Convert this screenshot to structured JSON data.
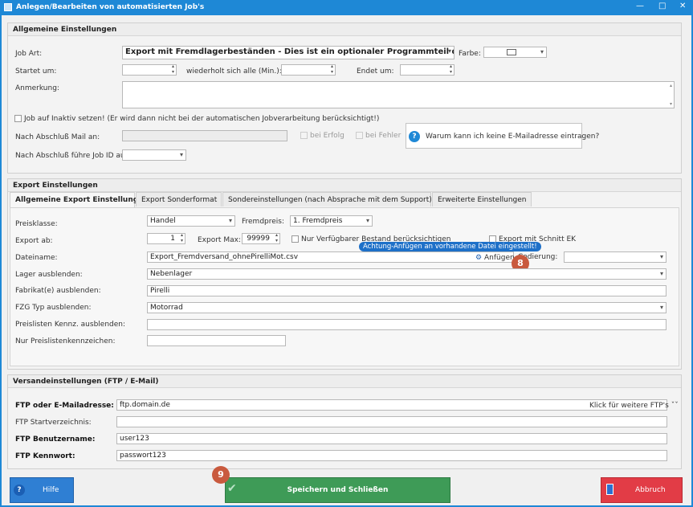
{
  "window": {
    "title": "Anlegen/Bearbeiten von automatisierten Job's",
    "minimize": "—",
    "maximize": "□",
    "close": "✕"
  },
  "general": {
    "header": "Allgemeine Einstellungen",
    "job_art_label": "Job Art:",
    "job_art_value": "Export mit Fremdlagerbeständen - Dies ist ein optionaler Programmteil den Sie...",
    "farbe_label": "Farbe:",
    "startet_label": "Startet um:",
    "wiederholt_label": "wiederholt sich alle (Min.):",
    "endet_label": "Endet um:",
    "anmerkung_label": "Anmerkung:",
    "inaktiv_label": "Job auf Inaktiv setzen! (Er wird dann nicht bei der automatischen Jobverarbeitung berücksichtigt!)",
    "mail_label": "Nach Abschluß Mail an:",
    "erfolg_label": "bei Erfolg",
    "fehler_label": "bei Fehler",
    "help_box_text": "Warum kann ich keine E-Mailadresse eintragen?",
    "job_id_label": "Nach Abschluß führe Job ID aus:"
  },
  "export": {
    "header": "Export Einstellungen",
    "tabs": [
      "Allgemeine Export Einstellungen",
      "Export Sonderformat",
      "Sondereinstellungen (nach Absprache mit dem Support)",
      "Erweiterte Einstellungen"
    ],
    "preisklasse_label": "Preisklasse:",
    "preisklasse_value": "Handel",
    "fremdpreis_label": "Fremdpreis:",
    "fremdpreis_value": "1. Fremdpreis",
    "export_ab_label": "Export ab:",
    "export_ab_value": "1",
    "export_max_label": "Export Max:",
    "export_max_value": "99999",
    "nur_verfuegbar_label": "Nur Verfügbarer Bestand berücksichtigen",
    "schnitt_ek_label": "Export mit Schnitt EK",
    "dateiname_label": "Dateiname:",
    "dateiname_value": "Export_Fremdversand_ohnePirelliMot.csv",
    "anfuegen_label": "Anfügen",
    "tooltip": "Achtung-Anfügen an vorhandene Datei eingestellt!",
    "codierung_label": "Codierung:",
    "lager_label": "Lager ausblenden:",
    "lager_value": "Nebenlager",
    "fabrikat_label": "Fabrikat(e) ausblenden:",
    "fabrikat_value": "Pirelli",
    "fzg_label": "FZG Typ  ausblenden:",
    "fzg_value": "Motorrad",
    "preislisten_label": "Preislisten Kennz. ausblenden:",
    "nur_preislisten_label": "Nur Preislistenkennzeichen:"
  },
  "versand": {
    "header": "Versandeinstellungen (FTP / E-Mail)",
    "ftp_label": "FTP oder E-Mailadresse:",
    "ftp_value": "ftp.domain.de",
    "ftp_more": "Klick für weitere FTP's ˇˇ",
    "start_dir_label": "FTP Startverzeichnis:",
    "user_label": "FTP Benutzername:",
    "user_value": "user123",
    "pw_label": "FTP Kennwort:",
    "pw_value": "passwort123"
  },
  "buttons": {
    "help": "Hilfe",
    "save": "Speichern und Schließen",
    "cancel": "Abbruch"
  },
  "badges": {
    "anfuegen": "8",
    "save": "9"
  },
  "colors": {
    "title_bar": "#1e88d6",
    "help_button": "#2f7fd3",
    "save_button": "#3e9b57",
    "cancel_button": "#e23c46",
    "badge": "#c95a3e"
  }
}
